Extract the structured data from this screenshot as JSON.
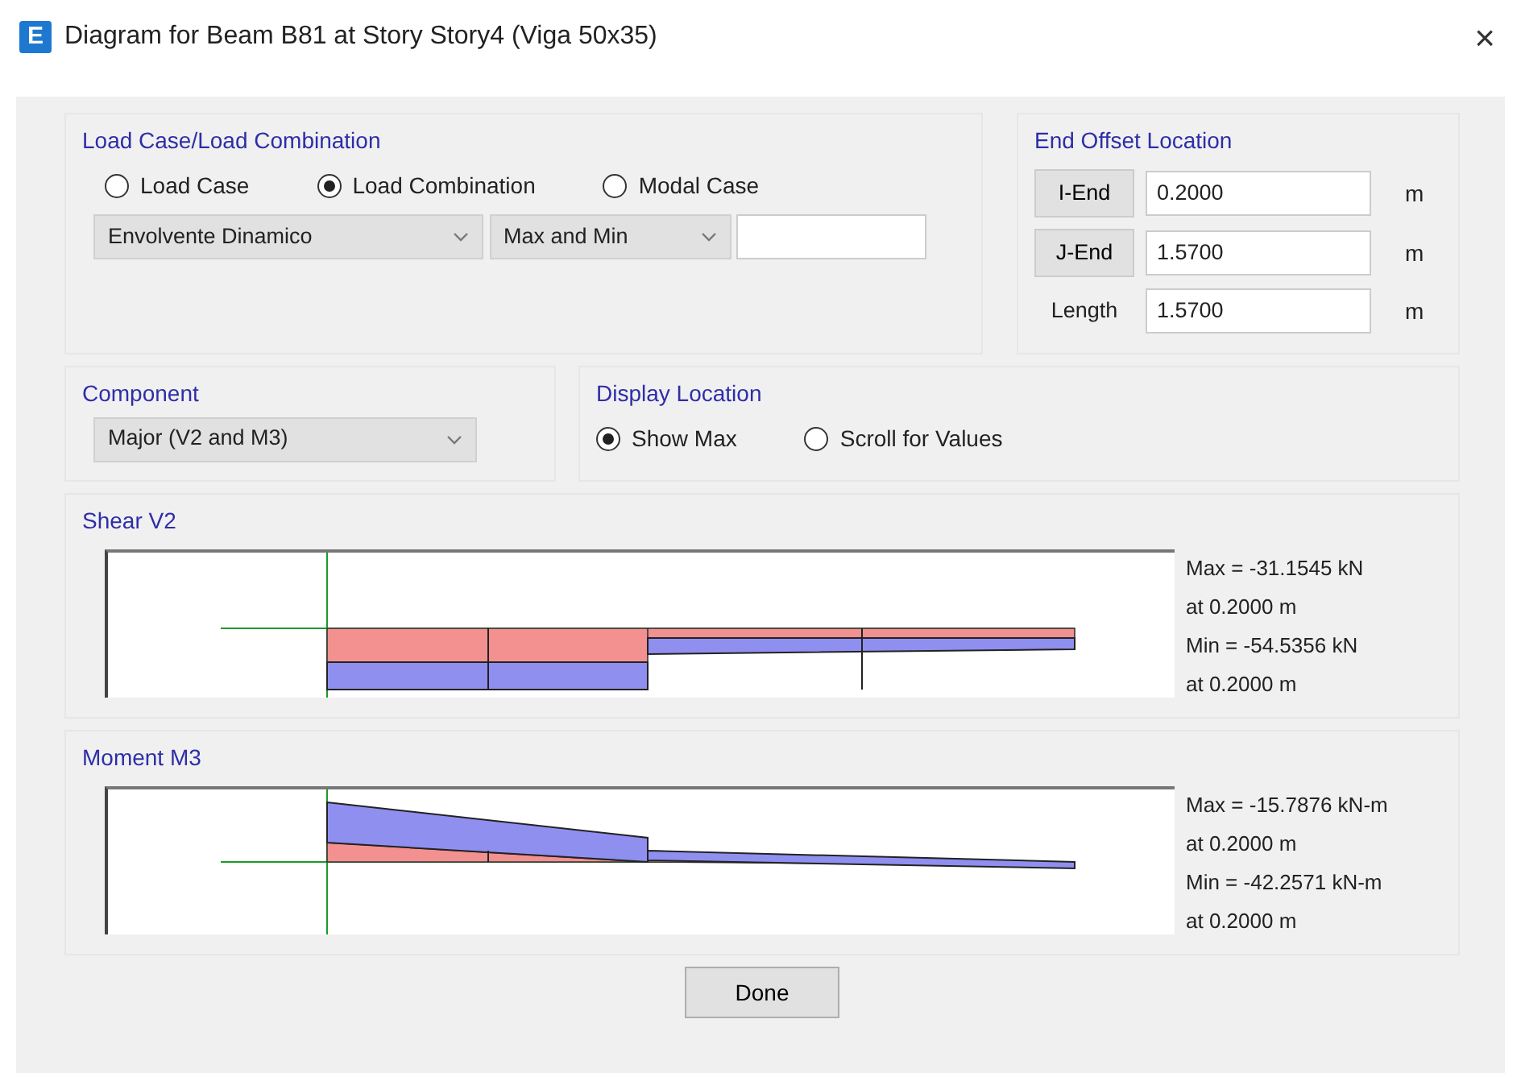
{
  "window": {
    "icon": "E",
    "title": "Diagram for Beam B81 at Story Story4 (Viga 50x35)",
    "close": "×"
  },
  "load_group": {
    "title": "Load Case/Load Combination",
    "options": [
      {
        "label": "Load Case",
        "selected": false
      },
      {
        "label": "Load Combination",
        "selected": true
      },
      {
        "label": "Modal Case",
        "selected": false
      }
    ],
    "case_select": "Envolvente Dinamico",
    "mode_select": "Max and Min"
  },
  "end_offset": {
    "title": "End Offset Location",
    "rows": [
      {
        "kind": "button",
        "label": "I-End",
        "value": "0.2000",
        "unit": "m"
      },
      {
        "kind": "button",
        "label": "J-End",
        "value": "1.5700",
        "unit": "m"
      },
      {
        "kind": "label",
        "label": "Length",
        "value": "1.5700",
        "unit": "m"
      }
    ]
  },
  "component": {
    "title": "Component",
    "select": "Major (V2 and M3)"
  },
  "display_location": {
    "title": "Display Location",
    "options": [
      {
        "label": "Show Max",
        "selected": true
      },
      {
        "label": "Scroll for Values",
        "selected": false
      }
    ]
  },
  "diagrams": [
    {
      "kind": "shear",
      "title": "Shear V2",
      "readouts": [
        "Max = -31.1545 kN",
        "at 0.2000 m",
        "Min = -54.5356 kN",
        "at 0.2000 m"
      ]
    },
    {
      "kind": "moment",
      "title": "Moment M3",
      "readouts": [
        "Max = -15.7876 kN-m",
        "at 0.2000 m",
        "Min = -42.2571 kN-m",
        "at 0.2000 m"
      ]
    }
  ],
  "buttons": [
    "Done"
  ]
}
